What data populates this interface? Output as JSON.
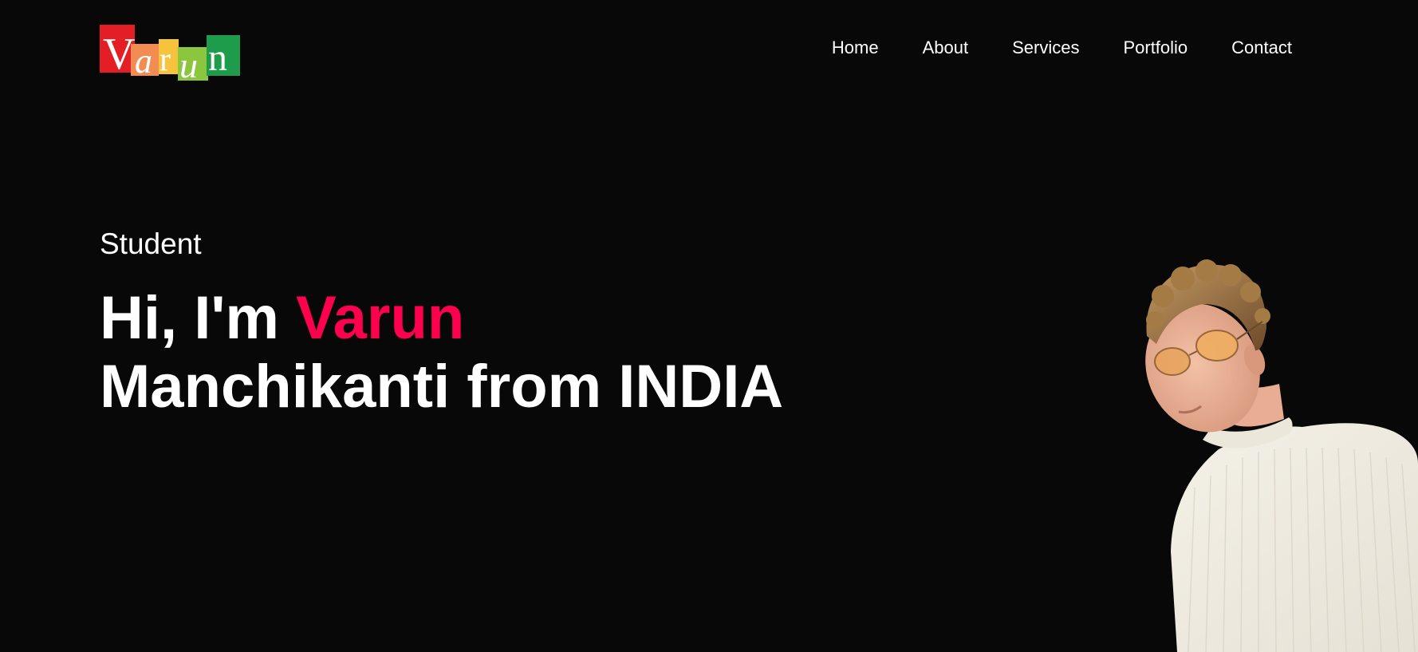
{
  "logo": {
    "text": "Varun",
    "letters": [
      "V",
      "a",
      "r",
      "u",
      "n"
    ],
    "tile_colors": [
      "#e31e24",
      "#f28c52",
      "#f6c33c",
      "#8cc63f",
      "#1e9b4b"
    ]
  },
  "nav": {
    "items": [
      {
        "label": "Home"
      },
      {
        "label": "About"
      },
      {
        "label": "Services"
      },
      {
        "label": "Portfolio"
      },
      {
        "label": "Contact"
      }
    ]
  },
  "hero": {
    "subtitle": "Student",
    "greeting": "Hi, I'm ",
    "name_highlight": "Varun",
    "name_rest": "Manchikanti from INDIA",
    "accent_color": "#ff004f"
  },
  "colors": {
    "background": "#080808",
    "text": "#ffffff"
  },
  "photo": {
    "icon": "profile-photo"
  }
}
